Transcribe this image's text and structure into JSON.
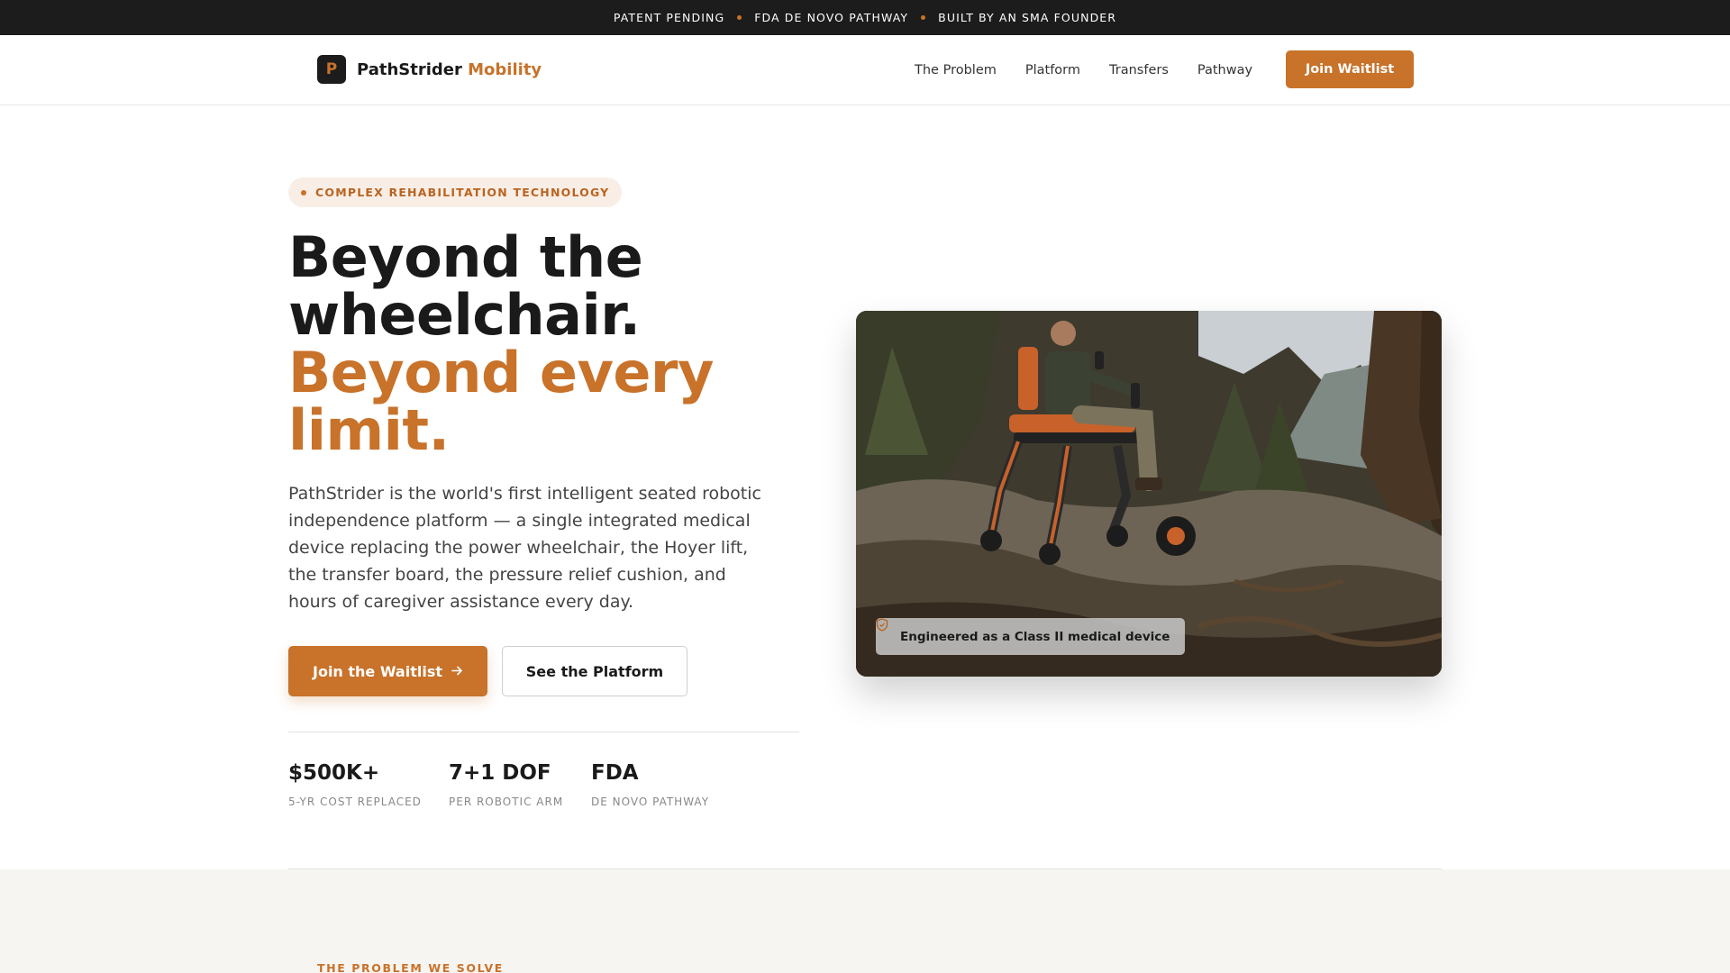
{
  "announcement": {
    "items": [
      "PATENT PENDING",
      "FDA DE NOVO PATHWAY",
      "BUILT BY AN SMA FOUNDER"
    ]
  },
  "brand": {
    "logo_letter": "P",
    "name": "PathStrider",
    "accent": "Mobility"
  },
  "nav": {
    "items": [
      "The Problem",
      "Platform",
      "Transfers",
      "Pathway"
    ],
    "cta": "Join Waitlist"
  },
  "hero": {
    "badge": "COMPLEX REHABILITATION TECHNOLOGY",
    "headline_line1": "Beyond the wheelchair.",
    "headline_line2": "Beyond every limit.",
    "lede": "PathStrider is the world's first intelligent seated robotic independence platform — a single integrated medical device replacing the power wheelchair, the Hoyer lift, the transfer board, the pressure relief cushion, and hours of caregiver assistance every day.",
    "primary_cta": "Join the Waitlist",
    "primary_cta_icon": "arrow-right-icon",
    "secondary_cta": "See the Platform",
    "stats": [
      {
        "value": "$500K+",
        "label": "5-YR COST REPLACED"
      },
      {
        "value": "7+1 DOF",
        "label": "PER ROBOTIC ARM"
      },
      {
        "value": "FDA",
        "label": "DE NOVO PATHWAY"
      }
    ],
    "image_caption": "Engineered as a Class II medical device",
    "image_caption_icon": "shield-icon"
  },
  "problem": {
    "eyebrow": "THE PROBLEM WE SOLVE"
  },
  "colors": {
    "accent": "#c8722a",
    "dark": "#1c1c1c",
    "section_bg": "#f7f5f1"
  }
}
